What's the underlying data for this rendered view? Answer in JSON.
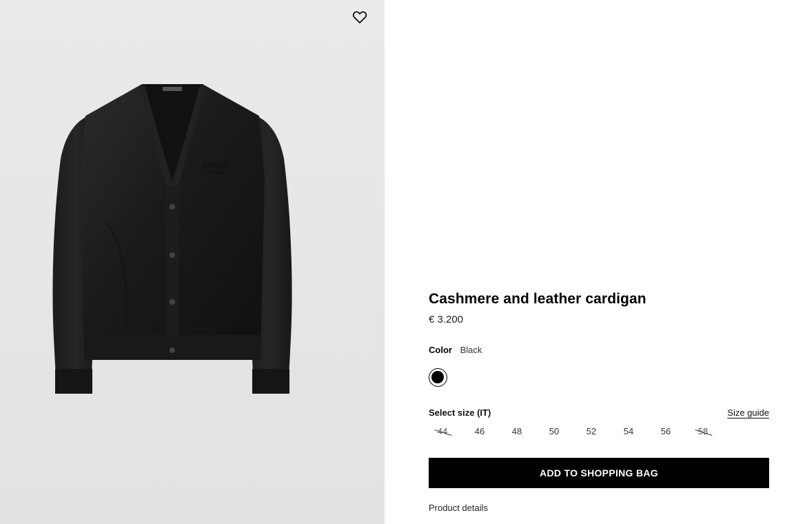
{
  "product": {
    "title": "Cashmere and leather cardigan",
    "price": "€ 3.200",
    "image_alt": "Black cashmere and leather cardigan"
  },
  "wishlist": {
    "icon": "heart-icon"
  },
  "color": {
    "label": "Color",
    "value": "Black",
    "swatches": [
      {
        "name": "Black",
        "hex": "#000000",
        "selected": true
      }
    ]
  },
  "size": {
    "label": "Select size (IT)",
    "guide_label": "Size guide",
    "options": [
      {
        "label": "44",
        "available": false
      },
      {
        "label": "46",
        "available": true
      },
      {
        "label": "48",
        "available": true
      },
      {
        "label": "50",
        "available": true
      },
      {
        "label": "52",
        "available": true
      },
      {
        "label": "54",
        "available": true
      },
      {
        "label": "56",
        "available": true
      },
      {
        "label": "58",
        "available": false
      }
    ]
  },
  "actions": {
    "add_to_bag": "ADD TO SHOPPING BAG",
    "product_details": "Product details"
  },
  "colors": {
    "gallery_bg": "#e6e6e6",
    "button_bg": "#000000",
    "button_text": "#ffffff"
  }
}
